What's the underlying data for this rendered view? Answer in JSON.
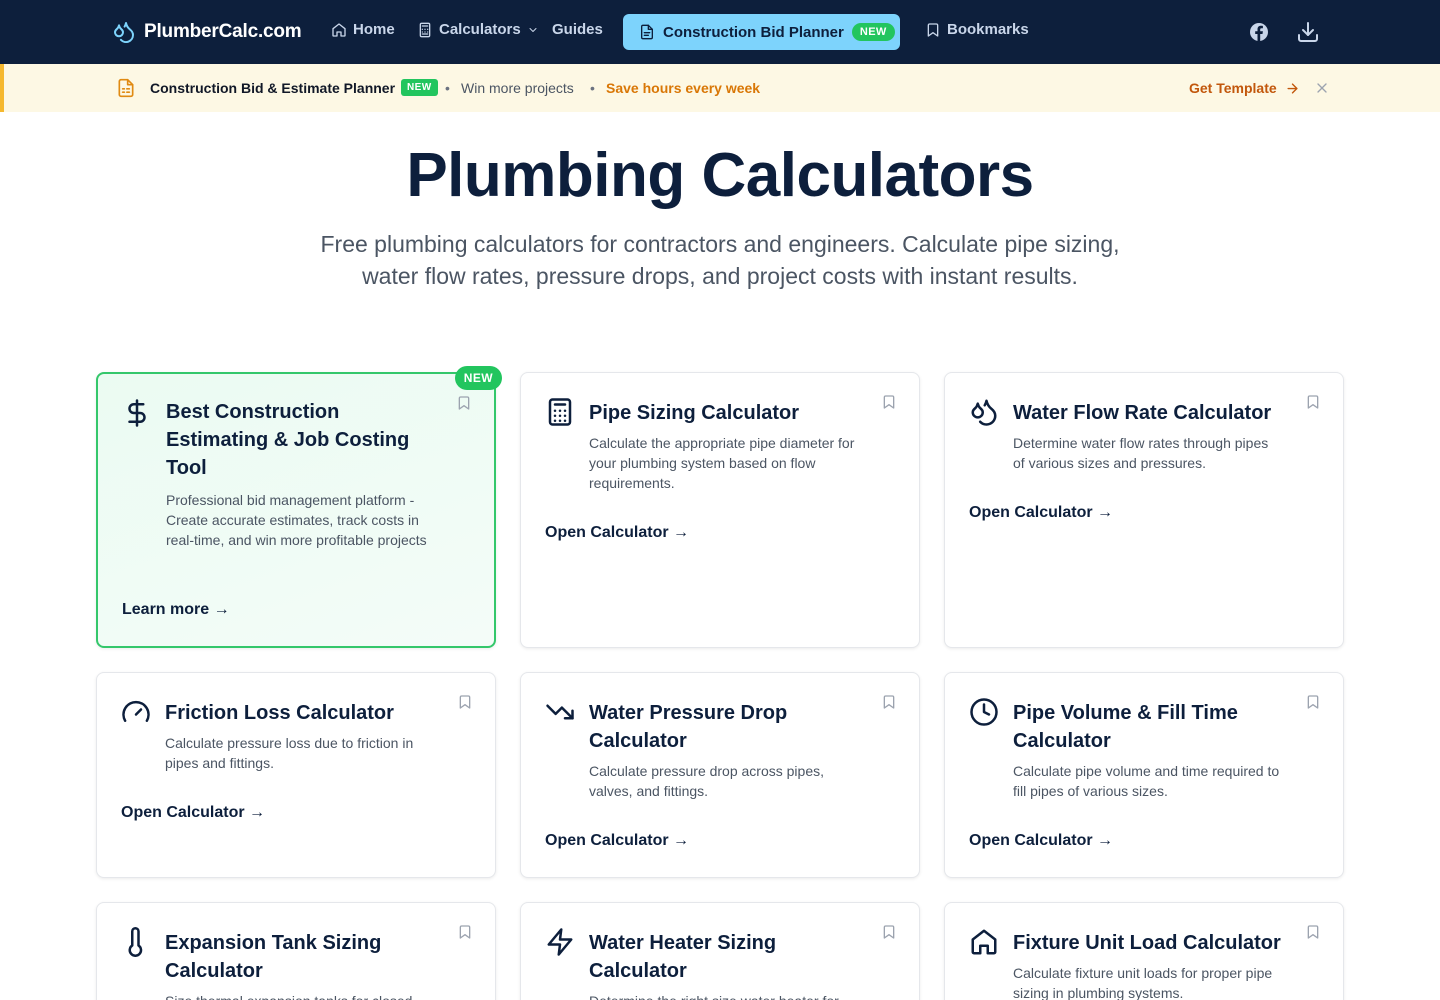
{
  "nav": {
    "brand": "PlumberCalc.com",
    "home": "Home",
    "calculators": "Calculators",
    "guides": "Guides",
    "planner": "Construction Bid Planner",
    "planner_badge": "NEW",
    "bookmarks": "Bookmarks"
  },
  "announcement": {
    "title": "Construction Bid & Estimate Planner",
    "badge": "NEW",
    "dot": "•",
    "text1": "Win more projects",
    "text2": "Save hours every week",
    "cta": "Get Template"
  },
  "hero": {
    "title": "Plumbing Calculators",
    "subtitle": "Free plumbing calculators for contractors and engineers. Calculate pipe sizing, water flow rates, pressure drops, and project costs with instant results."
  },
  "cards": [
    {
      "icon": "dollar-icon",
      "title": "Best Construction Estimating & Job Costing Tool",
      "description": "Professional bid management platform - Create accurate estimates, track costs in real-time, and win more profitable projects",
      "link": "Learn more →",
      "badge": "NEW"
    },
    {
      "icon": "calculator-icon",
      "title": "Pipe Sizing Calculator",
      "description": "Calculate the appropriate pipe diameter for your plumbing system based on flow requirements.",
      "link": "Open Calculator →"
    },
    {
      "icon": "droplets-icon",
      "title": "Water Flow Rate Calculator",
      "description": "Determine water flow rates through pipes of various sizes and pressures.",
      "link": "Open Calculator →"
    },
    {
      "icon": "gauge-icon",
      "title": "Friction Loss Calculator",
      "description": "Calculate pressure loss due to friction in pipes and fittings.",
      "link": "Open Calculator →"
    },
    {
      "icon": "trending-down-icon",
      "title": "Water Pressure Drop Calculator",
      "description": "Calculate pressure drop across pipes, valves, and fittings.",
      "link": "Open Calculator →"
    },
    {
      "icon": "clock-icon",
      "title": "Pipe Volume & Fill Time Calculator",
      "description": "Calculate pipe volume and time required to fill pipes of various sizes.",
      "link": "Open Calculator →"
    },
    {
      "icon": "thermometer-icon",
      "title": "Expansion Tank Sizing Calculator",
      "description": "Size thermal expansion tanks for closed",
      "link": ""
    },
    {
      "icon": "zap-icon",
      "title": "Water Heater Sizing Calculator",
      "description": "Determine the right size water heater for",
      "link": ""
    },
    {
      "icon": "home-icon",
      "title": "Fixture Unit Load Calculator",
      "description": "Calculate fixture unit loads for proper pipe sizing in plumbing systems.",
      "link": ""
    }
  ]
}
